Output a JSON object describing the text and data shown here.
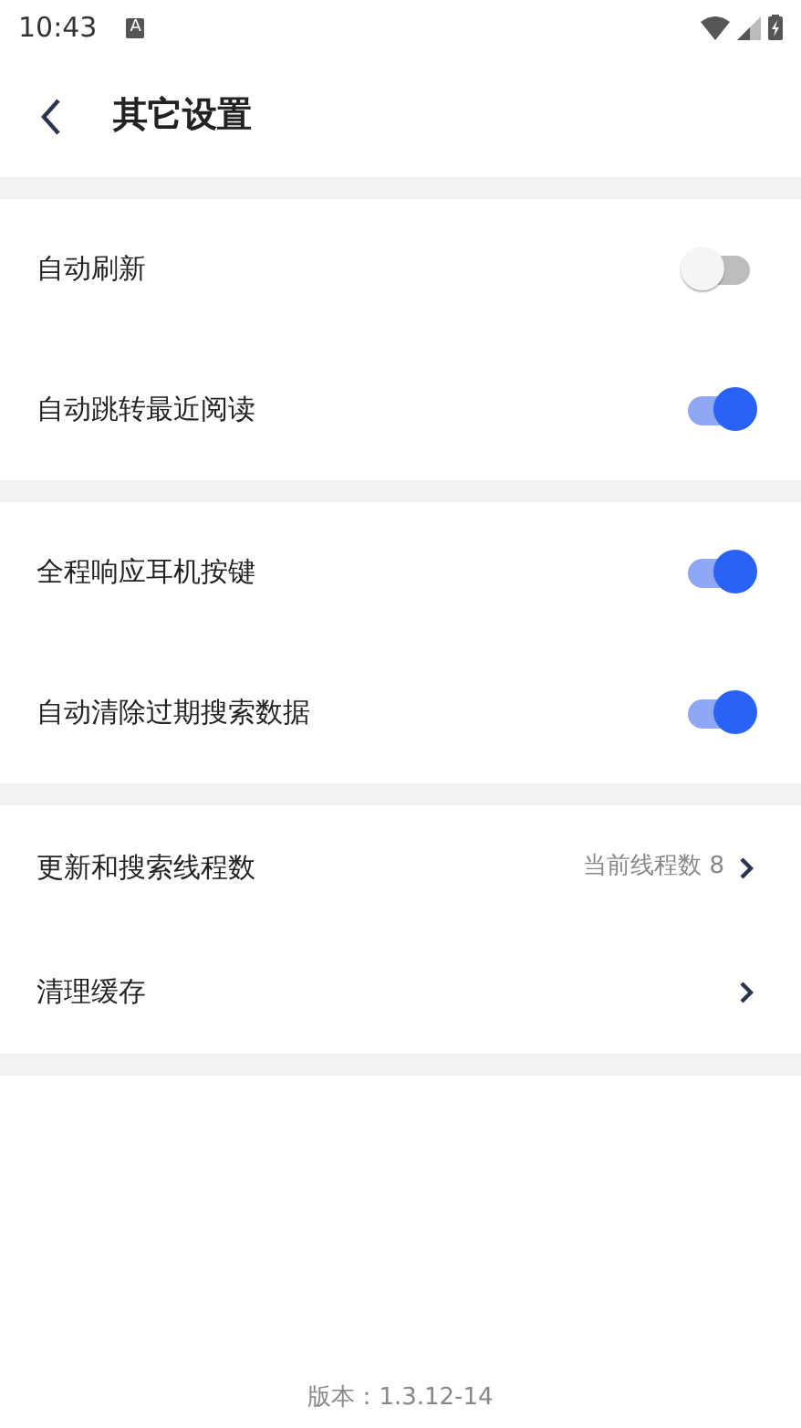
{
  "status_bar": {
    "time": "10:43",
    "badge": "A"
  },
  "header": {
    "title": "其它设置"
  },
  "groups": [
    {
      "items": [
        {
          "kind": "toggle",
          "label": "自动刷新",
          "on": false
        },
        {
          "kind": "toggle",
          "label": "自动跳转最近阅读",
          "on": true
        }
      ]
    },
    {
      "items": [
        {
          "kind": "toggle",
          "label": "全程响应耳机按键",
          "on": true
        },
        {
          "kind": "toggle",
          "label": "自动清除过期搜索数据",
          "on": true
        }
      ]
    },
    {
      "items": [
        {
          "kind": "link",
          "label": "更新和搜索线程数",
          "value": "当前线程数 8"
        },
        {
          "kind": "link",
          "label": "清理缓存"
        }
      ]
    }
  ],
  "version": "版本：1.3.12-14"
}
